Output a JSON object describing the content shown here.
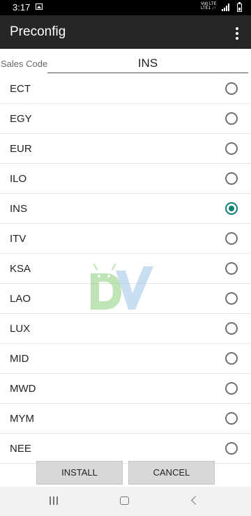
{
  "status_bar": {
    "time": "3:17",
    "network_top": "Vol) LTE",
    "network_bottom": "LTE1 ↓↑"
  },
  "app_bar": {
    "title": "Preconfig",
    "menu_icon": "overflow-menu-icon"
  },
  "sales_code": {
    "label": "Sales Code",
    "value": "INS"
  },
  "list": {
    "selected": "INS",
    "items": [
      {
        "label": "ECT"
      },
      {
        "label": "EGY"
      },
      {
        "label": "EUR"
      },
      {
        "label": "ILO"
      },
      {
        "label": "INS"
      },
      {
        "label": "ITV"
      },
      {
        "label": "KSA"
      },
      {
        "label": "LAO"
      },
      {
        "label": "LUX"
      },
      {
        "label": "MID"
      },
      {
        "label": "MWD"
      },
      {
        "label": "MYM"
      },
      {
        "label": "NEE"
      }
    ]
  },
  "buttons": {
    "install": "INSTALL",
    "cancel": "CANCEL"
  },
  "colors": {
    "accent": "#0b7f72",
    "app_bar": "#262626",
    "status_bar": "#000000"
  }
}
